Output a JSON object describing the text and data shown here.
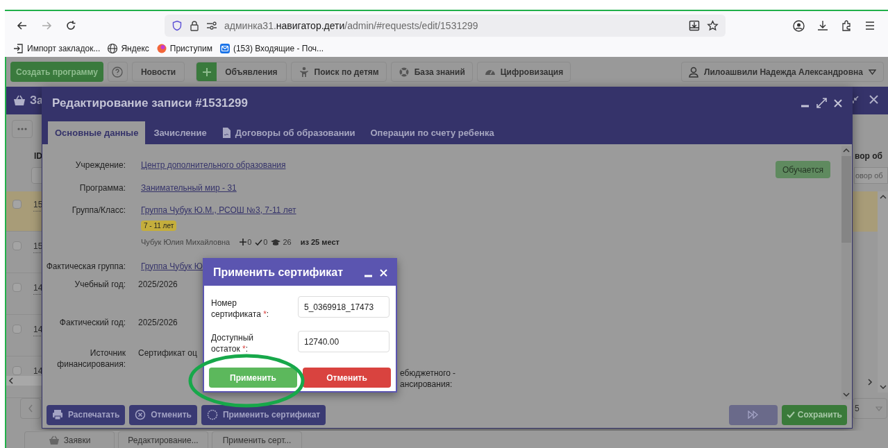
{
  "browser": {
    "address_prefix": "админка31.",
    "address_domain": "навигатор.дети",
    "address_path": "/admin/#requests/edit/1531299",
    "bookmarks": [
      {
        "kind": "import",
        "label": "Импорт закладок..."
      },
      {
        "kind": "globe",
        "label": "Яндекс"
      },
      {
        "kind": "ball",
        "label": "Приступим"
      },
      {
        "kind": "mail",
        "label": "(153) Входящие - Поч..."
      }
    ]
  },
  "app_toolbar": {
    "buttons": [
      {
        "kind": "primary",
        "label": "Создать программу"
      },
      {
        "kind": "help"
      },
      {
        "kind": "plain",
        "label": "Новости"
      },
      {
        "kind": "plus",
        "label": "Объявления"
      },
      {
        "kind": "person",
        "label": "Поиск по детям"
      },
      {
        "kind": "lifebuoy",
        "label": "База знаний"
      },
      {
        "kind": "gauge",
        "label": "Цифровизация"
      }
    ],
    "user": "Лилоашвили Надежда Александровна"
  },
  "requests_window": {
    "title": "За",
    "id_header": "ID",
    "right_header": "вор об",
    "right_filter": {
      "placeholder": "овор об"
    },
    "rows": [
      {
        "id": "15",
        "selected": true
      },
      {
        "id": "15",
        "selected": false
      },
      {
        "id": "14",
        "selected": false
      },
      {
        "id": "14",
        "selected": false
      },
      {
        "id": "14",
        "selected": false
      }
    ],
    "pager_value": "5"
  },
  "edit_dialog": {
    "title": "Редактирование записи #1531299",
    "tabs": [
      {
        "label": "Основные данные",
        "selected": true,
        "icon": false
      },
      {
        "label": "Зачисление",
        "selected": false,
        "icon": false
      },
      {
        "label": "Договоры об образовании",
        "selected": false,
        "icon": true
      },
      {
        "label": "Операции по счету ребенка",
        "selected": false,
        "icon": false
      }
    ],
    "status": "Обучается",
    "fields": [
      {
        "kind": "link",
        "label": "Учреждение:",
        "value": "Центр дополнительного образования"
      },
      {
        "kind": "link",
        "label": "Программа:",
        "value": "Занимательный мир - 31"
      },
      {
        "kind": "group",
        "label": "Группа/Класс:",
        "value": "Группа Чубук Ю.М., РСОШ №3, 7-11 лет",
        "age_badge": "7 - 11 лет",
        "teacher": "Чубук Юлия Михайловна",
        "added": "0",
        "confirmed": "0",
        "students": "26",
        "capacity": "из 25 мест"
      },
      {
        "kind": "link",
        "label": "Фактическая группа:",
        "value": "Группа Чубук Ю"
      },
      {
        "kind": "text",
        "label": "Учебный год:",
        "value": "2025/2026"
      },
      {
        "kind": "text",
        "label": "Фактический год:",
        "value": "2025/2026"
      },
      {
        "kind": "text",
        "label": "Источник финансирования:",
        "value": "Сертификат оц",
        "side_label": "ебюджетного ансирования:",
        "side_value": "-"
      }
    ],
    "footer_left": [
      {
        "kind": "print",
        "label": "Распечатать"
      },
      {
        "kind": "cancel",
        "label": "Отменить"
      },
      {
        "kind": "certificate",
        "label": "Применить сертификат"
      }
    ],
    "save": "Сохранить"
  },
  "certificate_dialog": {
    "title": "Применить сертификат",
    "fields": [
      {
        "label": "Номер сертификата",
        "required_mark": "*",
        "label_end": ":",
        "value": "5_0369918_17473"
      },
      {
        "label": "Доступный остаток",
        "required_mark": "*",
        "label_end": ":",
        "value": "12740.00"
      }
    ],
    "apply": "Применить",
    "cancel": "Отменить"
  },
  "taskbar": [
    {
      "kind": "basket",
      "label": "Заявки"
    },
    {
      "kind": "plain",
      "label": "Редактирование..."
    },
    {
      "kind": "plain",
      "label": "Применить серт..."
    }
  ]
}
